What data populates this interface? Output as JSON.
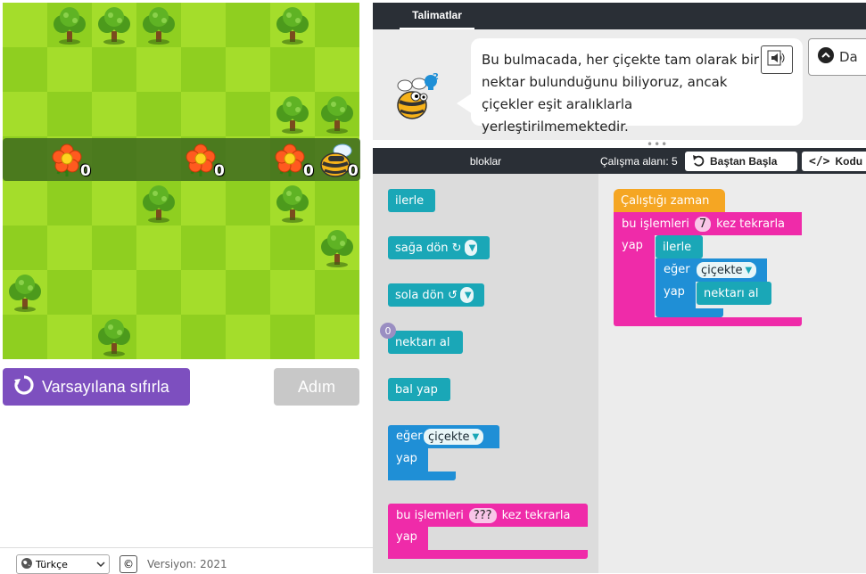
{
  "game": {
    "flowers": [
      {
        "nectar": "0"
      },
      {
        "nectar": "0"
      },
      {
        "nectar": "0"
      }
    ],
    "bee_nectar": "0"
  },
  "controls": {
    "reset_label": "Varsayılana sıfırla",
    "step_label": "Adım"
  },
  "footer": {
    "language": "Türkçe",
    "copyright_symbol": "©",
    "version": "Versiyon: 2021"
  },
  "instructions": {
    "tab_label": "Talimatlar",
    "text": "Bu bulmacada, her çiçekte tam olarak bir nektar bulunduğunu biliyoruz, ancak çiçekler eşit aralıklarla yerleştirilmemektedir.",
    "hint_badge": "2",
    "more_label": "Da"
  },
  "toolbox": {
    "header": "bloklar",
    "blocks": {
      "forward": "ilerle",
      "turn_right": "sağa dön ↻",
      "turn_left": "sola dön ↺",
      "get_nectar": "nektarı al",
      "get_nectar_count": "0",
      "make_honey": "bal yap",
      "if_label": "eğer",
      "if_condition": "çiçekte",
      "do_label": "yap",
      "repeat_prefix": "bu işlemleri",
      "repeat_count": "???",
      "repeat_suffix": "kez tekrarla",
      "repeat_do": "yap"
    }
  },
  "workspace": {
    "header": "Çalışma alanı: 5",
    "start_over": "Baştan Başla",
    "code_button": "Kodu",
    "program": {
      "when_run": "Çalıştığı zaman",
      "repeat_prefix": "bu işlemleri",
      "repeat_count": "7",
      "repeat_suffix": "kez tekrarla",
      "do_label": "yap",
      "forward": "ilerle",
      "if_label": "eğer",
      "if_condition": "çiçekte",
      "if_do": "yap",
      "get_nectar": "nektarı al"
    }
  },
  "colors": {
    "grass_light": "#a4dd2b",
    "grass_dark": "#8fcf20",
    "path": "#3f6b1e",
    "motion_block": "#1aa7b7",
    "logic_block": "#1f8fd6",
    "loop_block": "#ef2ba9",
    "event_block": "#f5a623",
    "reset_button": "#7d4fbf"
  }
}
